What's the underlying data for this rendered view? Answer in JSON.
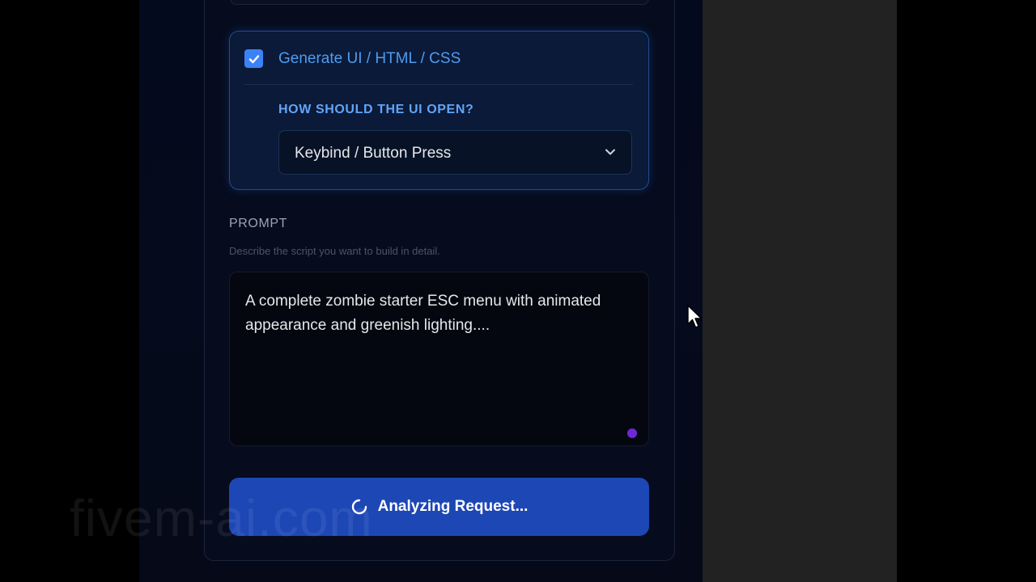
{
  "ui_options": {
    "generate_ui_label": "Generate UI / HTML / CSS",
    "generate_ui_checked": true,
    "open_question": "HOW SHOULD THE UI OPEN?",
    "open_method_selected": "Keybind / Button Press"
  },
  "prompt": {
    "label": "PROMPT",
    "hint": "Describe the script you want to build in detail.",
    "value": "A complete zombie starter ESC menu with animated appearance and greenish lighting...."
  },
  "submit": {
    "label": "Analyzing Request..."
  },
  "watermark": "fivem-ai.com",
  "colors": {
    "accent": "#3b82f6",
    "button": "#1d47b5",
    "background": "#050b1c"
  },
  "icons": {
    "checkbox": "checkmark-icon",
    "select": "chevron-down-icon",
    "loading": "spinner-icon",
    "pointer": "mouse-cursor-icon"
  }
}
